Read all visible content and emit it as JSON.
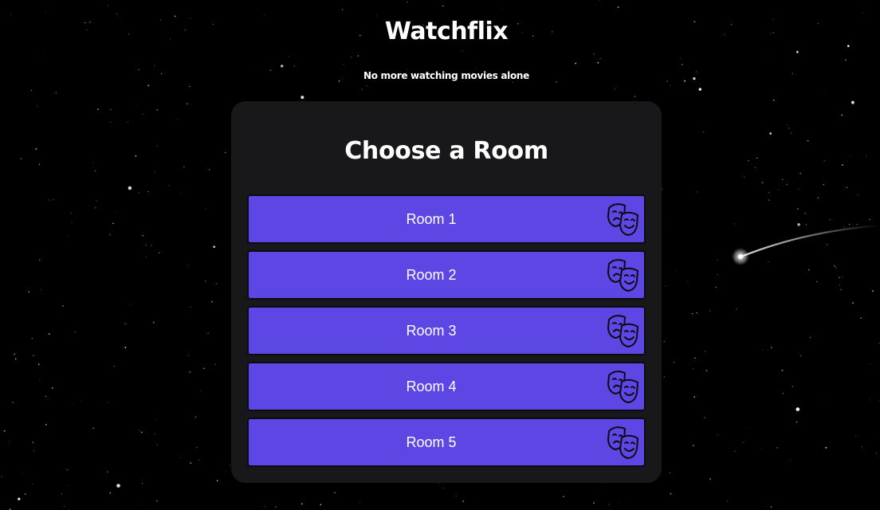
{
  "header": {
    "title": "Watchflix",
    "tagline": "No more watching movies alone"
  },
  "panel": {
    "title": "Choose a Room"
  },
  "rooms": [
    {
      "label": "Room 1",
      "icon": "theater-masks-icon"
    },
    {
      "label": "Room 2",
      "icon": "theater-masks-icon"
    },
    {
      "label": "Room 3",
      "icon": "theater-masks-icon"
    },
    {
      "label": "Room 4",
      "icon": "theater-masks-icon"
    },
    {
      "label": "Room 5",
      "icon": "theater-masks-icon"
    }
  ],
  "colors": {
    "background": "#000000",
    "panel": "#18181b",
    "accent": "#5c46e4",
    "text": "#ffffff"
  }
}
